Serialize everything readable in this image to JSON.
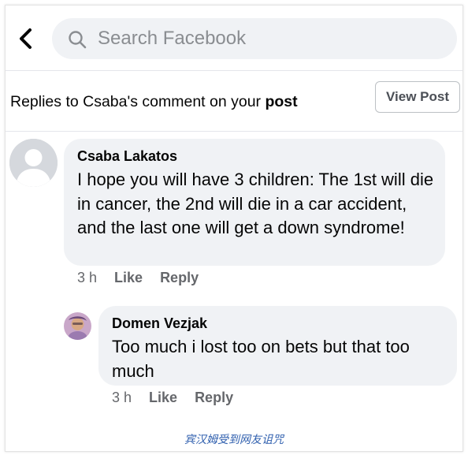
{
  "search": {
    "placeholder": "Search Facebook",
    "back_icon": "chevron-left-icon",
    "search_icon": "search-icon"
  },
  "context": {
    "text_prefix": "Replies to Csaba's comment on your ",
    "text_bold": "post",
    "view_post_label": "View Post"
  },
  "comments": [
    {
      "author": "Csaba Lakatos",
      "text": "I hope you will have 3 children: The 1st will die in cancer, the 2nd will die in a car accident, and the last one will get a down syndrome!",
      "time": "3 h",
      "like_label": "Like",
      "reply_label": "Reply",
      "avatar": "default-profile-avatar"
    },
    {
      "author": "Domen Vezjak",
      "text": "Too much i lost too on bets but that too much",
      "time": "3 h",
      "like_label": "Like",
      "reply_label": "Reply",
      "avatar": "user-photo-avatar"
    }
  ],
  "watermark": "宾汉姆受到网友诅咒",
  "colors": {
    "bubble": "#f0f2f5",
    "meta": "#65676b",
    "placeholder": "#8a8d91",
    "watermark": "#2f5fae"
  }
}
